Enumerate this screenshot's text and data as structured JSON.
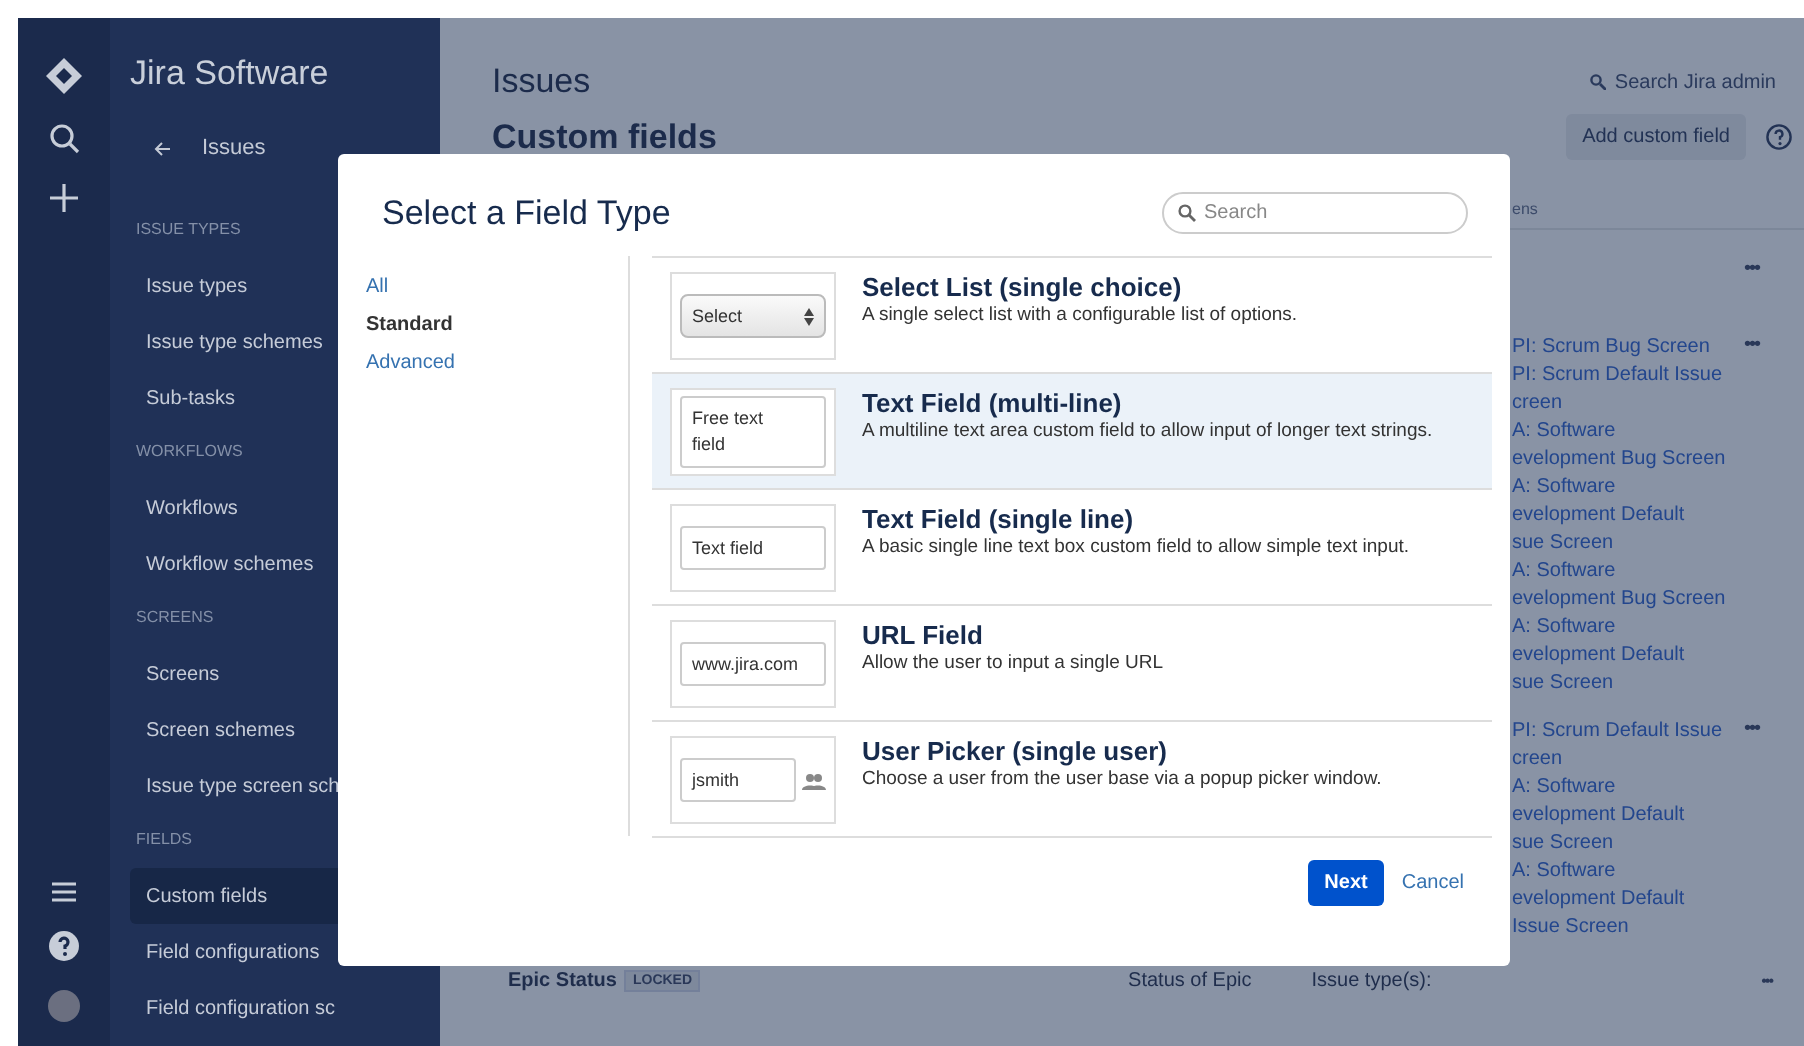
{
  "sidebar": {
    "product": "Jira Software",
    "back_label": "Issues",
    "sections": [
      {
        "heading": "ISSUE TYPES",
        "items": [
          {
            "label": "Issue types",
            "selected": false
          },
          {
            "label": "Issue type schemes",
            "selected": false
          },
          {
            "label": "Sub-tasks",
            "selected": false
          }
        ]
      },
      {
        "heading": "WORKFLOWS",
        "items": [
          {
            "label": "Workflows",
            "selected": false
          },
          {
            "label": "Workflow schemes",
            "selected": false
          }
        ]
      },
      {
        "heading": "SCREENS",
        "items": [
          {
            "label": "Screens",
            "selected": false
          },
          {
            "label": "Screen schemes",
            "selected": false
          },
          {
            "label": "Issue type screen sch",
            "selected": false
          }
        ]
      },
      {
        "heading": "FIELDS",
        "items": [
          {
            "label": "Custom fields",
            "selected": true
          },
          {
            "label": "Field configurations",
            "selected": false
          },
          {
            "label": "Field configuration sc",
            "selected": false
          }
        ]
      }
    ]
  },
  "header": {
    "title": "Issues",
    "search_link": "Search Jira admin",
    "page_title": "Custom fields",
    "add_button": "Add custom field"
  },
  "table": {
    "column_header": "ens",
    "rows": [
      {
        "screens": [],
        "actions": "•••"
      },
      {
        "screens": [
          "PI: Scrum Bug Screen",
          "PI: Scrum Default Issue",
          "creen",
          "A: Software",
          "evelopment Bug Screen",
          "A: Software",
          "evelopment Default",
          "sue Screen",
          "A: Software",
          "evelopment Bug Screen",
          "A: Software",
          "evelopment Default",
          "sue Screen"
        ],
        "actions": "•••"
      },
      {
        "screens": [
          "PI: Scrum Default Issue",
          "creen",
          "A: Software",
          "evelopment Default",
          "sue Screen",
          "A: Software",
          "evelopment Default",
          "Issue Screen"
        ],
        "actions": "•••"
      }
    ],
    "last_row": {
      "name": "Epic Status",
      "badge": "LOCKED",
      "column_2": "Status of Epic",
      "column_3": "Issue type(s):",
      "actions": "•••"
    }
  },
  "dialog": {
    "title": "Select a Field Type",
    "search": {
      "placeholder": "Search"
    },
    "categories": [
      {
        "label": "All",
        "selected": false
      },
      {
        "label": "Standard",
        "selected": true
      },
      {
        "label": "Advanced",
        "selected": false
      }
    ],
    "field_types": [
      {
        "kind": "select",
        "preview": "Select",
        "name": "Select List (single choice)",
        "description": "A single select list with a configurable list of options.",
        "selected": false
      },
      {
        "kind": "textarea",
        "preview": "Free text field",
        "name": "Text Field (multi-line)",
        "description": "A multiline text area custom field to allow input of longer text strings.",
        "selected": true
      },
      {
        "kind": "text",
        "preview": "Text field",
        "name": "Text Field (single line)",
        "description": "A basic single line text box custom field to allow simple text input.",
        "selected": false
      },
      {
        "kind": "text",
        "preview": "www.jira.com",
        "name": "URL Field",
        "description": "Allow the user to input a single URL",
        "selected": false
      },
      {
        "kind": "user",
        "preview": "jsmith",
        "name": "User Picker (single user)",
        "description": "Choose a user from the user base via a popup picker window.",
        "selected": false
      }
    ],
    "next_button": "Next",
    "cancel_link": "Cancel"
  }
}
